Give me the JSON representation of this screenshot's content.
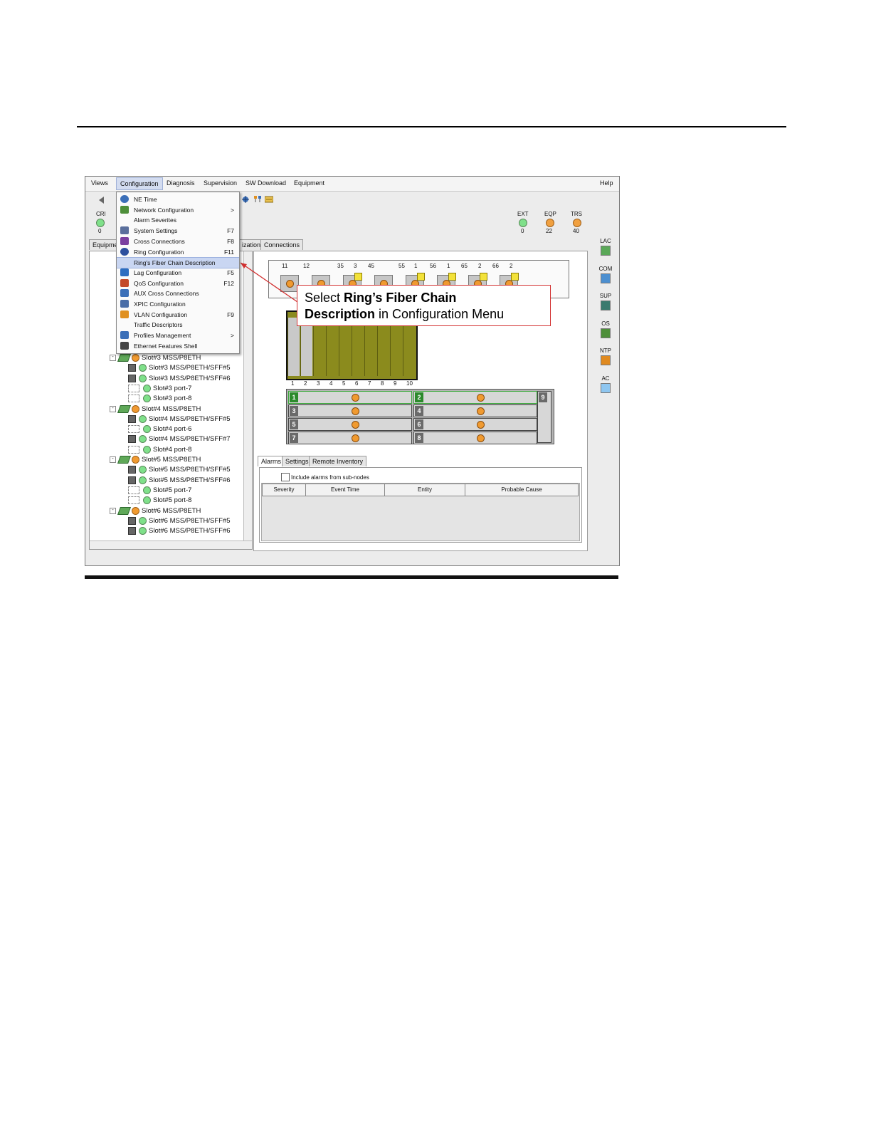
{
  "menubar": {
    "items": [
      "Views",
      "Configuration",
      "Diagnosis",
      "Supervision",
      "SW Download",
      "Equipment"
    ],
    "help": "Help"
  },
  "status": {
    "cri": {
      "label": "CRI",
      "value": "0"
    },
    "ext": {
      "label": "EXT",
      "value": "0"
    },
    "eqp": {
      "label": "EQP",
      "value": "22"
    },
    "trs": {
      "label": "TRS",
      "value": "40"
    }
  },
  "tabs": {
    "left_tab": "Equipme",
    "sync_tab": "ization",
    "connections_tab": "Connections"
  },
  "dropdown": {
    "items": [
      {
        "label": "NE Time",
        "key": "",
        "icon": "clock-icon"
      },
      {
        "label": "Network Configuration",
        "key": ">",
        "icon": "network-icon"
      },
      {
        "label": "Alarm Severites",
        "key": "",
        "icon": ""
      },
      {
        "label": "System Settings",
        "key": "F7",
        "icon": "settings-icon"
      },
      {
        "label": "Cross Connections",
        "key": "F8",
        "icon": "cross-icon"
      },
      {
        "label": "Ring Configuration",
        "key": "F11",
        "icon": "ring-icon"
      },
      {
        "label": "Ring's Fiber Chain Description",
        "key": "",
        "icon": ""
      },
      {
        "label": "Lag Configuration",
        "key": "F5",
        "icon": "lag-icon"
      },
      {
        "label": "QoS Configuration",
        "key": "F12",
        "icon": "qos-icon"
      },
      {
        "label": "AUX Cross Connections",
        "key": "",
        "icon": "aux-icon"
      },
      {
        "label": "XPIC Configuration",
        "key": "",
        "icon": "xpic-icon"
      },
      {
        "label": "VLAN Configuration",
        "key": "F9",
        "icon": "vlan-icon"
      },
      {
        "label": "Traffic Descriptors",
        "key": "",
        "icon": ""
      },
      {
        "label": "Profiles Management",
        "key": ">",
        "icon": "profiles-icon"
      },
      {
        "label": "Ethernet Features Shell",
        "key": "",
        "icon": "shell-icon"
      }
    ]
  },
  "tree": {
    "rows": [
      {
        "text": "Slot#3 MSS/P8ETH",
        "kind": "card"
      },
      {
        "text": "Slot#3 MSS/P8ETH/SFF#5",
        "kind": "port"
      },
      {
        "text": "Slot#3 MSS/P8ETH/SFF#6",
        "kind": "port"
      },
      {
        "text": "Slot#3  port-7",
        "kind": "dash"
      },
      {
        "text": "Slot#3  port-8",
        "kind": "dash"
      },
      {
        "text": "Slot#4 MSS/P8ETH",
        "kind": "card"
      },
      {
        "text": "Slot#4 MSS/P8ETH/SFF#5",
        "kind": "port"
      },
      {
        "text": "Slot#4  port-6",
        "kind": "dash"
      },
      {
        "text": "Slot#4 MSS/P8ETH/SFF#7",
        "kind": "port"
      },
      {
        "text": "Slot#4  port-8",
        "kind": "dash"
      },
      {
        "text": "Slot#5 MSS/P8ETH",
        "kind": "card"
      },
      {
        "text": "Slot#5 MSS/P8ETH/SFF#5",
        "kind": "port"
      },
      {
        "text": "Slot#5 MSS/P8ETH/SFF#6",
        "kind": "port"
      },
      {
        "text": "Slot#5  port-7",
        "kind": "dash"
      },
      {
        "text": "Slot#5  port-8",
        "kind": "dash"
      },
      {
        "text": "Slot#6 MSS/P8ETH",
        "kind": "card"
      },
      {
        "text": "Slot#6 MSS/P8ETH/SFF#5",
        "kind": "port"
      },
      {
        "text": "Slot#6 MSS/P8ETH/SFF#6",
        "kind": "port"
      }
    ]
  },
  "shelf": {
    "units": [
      "11",
      "12",
      "35",
      "3",
      "45",
      "55",
      "1",
      "56",
      "1",
      "65",
      "2",
      "66",
      "2"
    ]
  },
  "rack": {
    "slot_numbers": [
      "1",
      "2",
      "3",
      "4",
      "5",
      "6",
      "7",
      "8",
      "9",
      "10"
    ]
  },
  "chassis": {
    "cards": [
      "1",
      "2",
      "3",
      "4",
      "5",
      "6",
      "7",
      "8",
      "9"
    ]
  },
  "callout": {
    "line1_prefix": "Select ",
    "line1_bold": "Ring’s Fiber Chain",
    "line2_bold": "Description",
    "line2_suffix": " in Configuration Menu"
  },
  "bottom": {
    "tabs": [
      "Alarms",
      "Settings",
      "Remote Inventory"
    ],
    "checkbox_label": "Include alarms from sub-nodes",
    "columns": [
      "Severity",
      "Event Time",
      "Entity",
      "Probable Cause"
    ]
  },
  "side": {
    "labels": [
      "LAC",
      "COM",
      "SUP",
      "OS",
      "NTP",
      "AC"
    ]
  },
  "colors": {
    "menu_highlight": "#c9d6f2",
    "callout_border": "#d23030",
    "led_green": "#7fe08a",
    "led_orange": "#f09a30",
    "rack_olive": "#8a8a20"
  }
}
